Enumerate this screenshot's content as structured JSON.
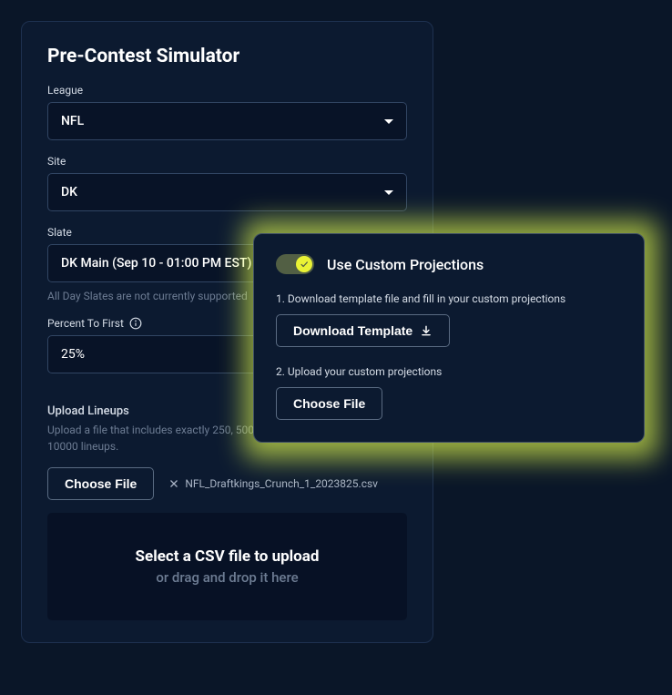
{
  "panel": {
    "title": "Pre-Contest Simulator",
    "league": {
      "label": "League",
      "value": "NFL"
    },
    "site": {
      "label": "Site",
      "value": "DK"
    },
    "slate": {
      "label": "Slate",
      "value": "DK Main (Sep 10 - 01:00 PM EST)",
      "helper": "All Day Slates are not currently supported"
    },
    "percent": {
      "label": "Percent To First",
      "value": "25%"
    },
    "upload": {
      "heading": "Upload Lineups",
      "description": "Upload a file that includes exactly 250, 500, 1000, 1500, or 2000, 5000, or 10000 lineups.",
      "choose_label": "Choose File",
      "file_name": "NFL_Draftkings_Crunch_1_2023825.csv",
      "drop_primary": "Select a CSV file to upload",
      "drop_secondary": "or drag and drop it here"
    }
  },
  "popover": {
    "toggle_label": "Use Custom Projections",
    "step1": "1. Download template file and fill in your custom projections",
    "download_label": "Download Template",
    "step2": "2. Upload your custom projections",
    "choose_label": "Choose File"
  }
}
